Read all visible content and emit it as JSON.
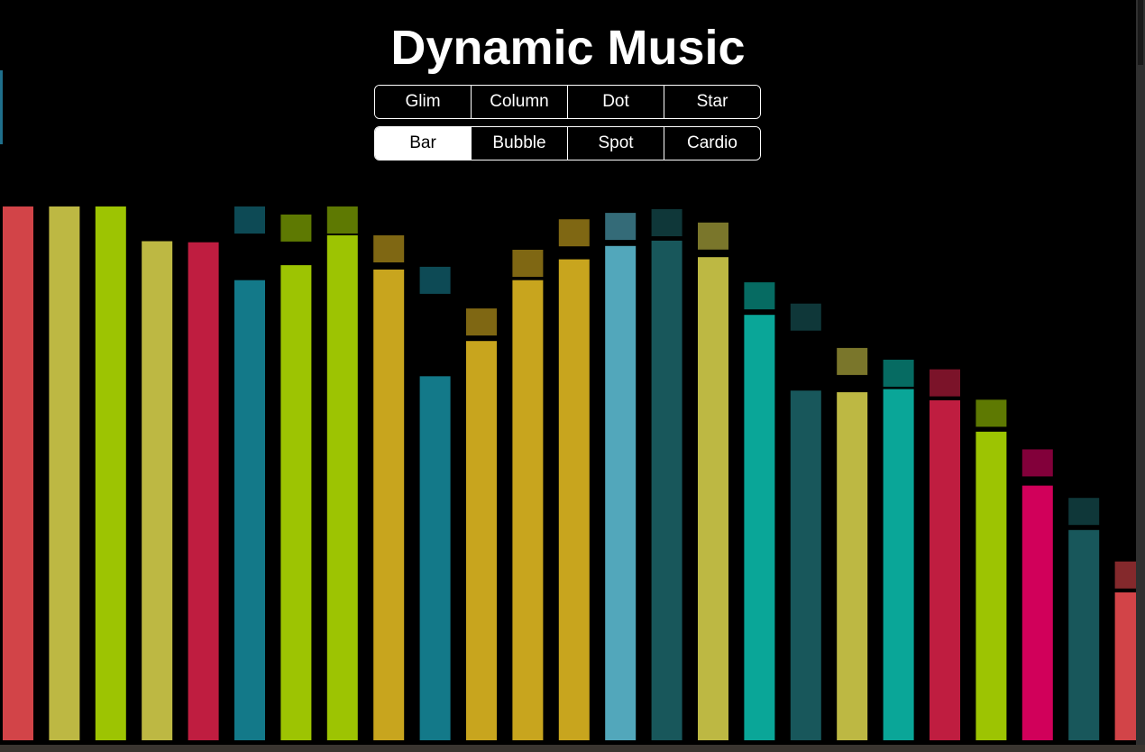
{
  "title": "Dynamic Music",
  "modes": {
    "row1": [
      "Glim",
      "Column",
      "Dot",
      "Star"
    ],
    "row2": [
      "Bar",
      "Bubble",
      "Spot",
      "Cardio"
    ],
    "active": "Bar"
  },
  "spectrum": {
    "max_level": 1.0,
    "bars": [
      {
        "level": 1.0,
        "cap": null,
        "color": "#d24448",
        "cap_color": null
      },
      {
        "level": 1.0,
        "cap": null,
        "color": "#bdb843",
        "cap_color": null
      },
      {
        "level": 1.0,
        "cap": null,
        "color": "#9dc402",
        "cap_color": null
      },
      {
        "level": 0.935,
        "cap": null,
        "color": "#bdb843",
        "cap_color": null
      },
      {
        "level": 0.933,
        "cap": null,
        "color": "#bf1d40",
        "cap_color": null
      },
      {
        "level": 0.862,
        "cap": 1.0,
        "color": "#137989",
        "cap_color": "#0d4a55"
      },
      {
        "level": 0.89,
        "cap": 0.985,
        "color": "#9dc402",
        "cap_color": "#5e7902"
      },
      {
        "level": 0.946,
        "cap": 1.0,
        "color": "#9dc402",
        "cap_color": "#5e7902"
      },
      {
        "level": 0.882,
        "cap": 0.946,
        "color": "#c8a51e",
        "cap_color": "#7f6713"
      },
      {
        "level": 0.682,
        "cap": 0.887,
        "color": "#137989",
        "cap_color": "#0d4a55"
      },
      {
        "level": 0.748,
        "cap": 0.809,
        "color": "#c8a51e",
        "cap_color": "#7f6713"
      },
      {
        "level": 0.862,
        "cap": 0.919,
        "color": "#c8a51e",
        "cap_color": "#7f6713"
      },
      {
        "level": 0.901,
        "cap": 0.976,
        "color": "#c8a51e",
        "cap_color": "#7f6713"
      },
      {
        "level": 0.926,
        "cap": 0.988,
        "color": "#52a7bb",
        "cap_color": "#346b78"
      },
      {
        "level": 0.936,
        "cap": 0.995,
        "color": "#18575b",
        "cap_color": "#0f3739"
      },
      {
        "level": 0.905,
        "cap": 0.97,
        "color": "#bdb843",
        "cap_color": "#7a762b"
      },
      {
        "level": 0.797,
        "cap": 0.858,
        "color": "#0aa698",
        "cap_color": "#066b62"
      },
      {
        "level": 0.655,
        "cap": 0.818,
        "color": "#18575b",
        "cap_color": "#0f3739"
      },
      {
        "level": 0.652,
        "cap": 0.735,
        "color": "#bdb843",
        "cap_color": "#7a762b"
      },
      {
        "level": 0.658,
        "cap": 0.713,
        "color": "#0aa698",
        "cap_color": "#066b62"
      },
      {
        "level": 0.637,
        "cap": 0.695,
        "color": "#bf1d40",
        "cap_color": "#7b1329"
      },
      {
        "level": 0.578,
        "cap": 0.638,
        "color": "#9dc402",
        "cap_color": "#5e7902"
      },
      {
        "level": 0.477,
        "cap": 0.545,
        "color": "#d1005a",
        "cap_color": "#82003a"
      },
      {
        "level": 0.394,
        "cap": 0.454,
        "color": "#18575b",
        "cap_color": "#0f3739"
      },
      {
        "level": 0.277,
        "cap": 0.335,
        "color": "#d24448",
        "cap_color": "#84292c"
      }
    ]
  }
}
